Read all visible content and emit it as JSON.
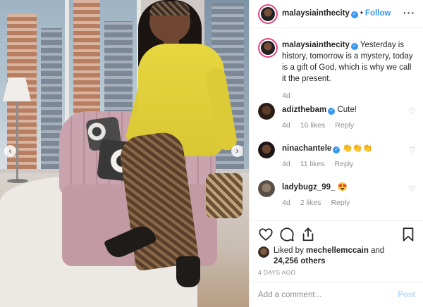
{
  "header": {
    "username": "malaysiainthecity",
    "separator": "•",
    "follow_label": "Follow",
    "more_icon": "more-horizontal-icon",
    "more_glyph": "···"
  },
  "caption": {
    "username": "malaysiainthecity",
    "text": "Yesterday is history, tomorrow is a mystery, today is a gift of God, which is why we call it the present.",
    "age": "4d"
  },
  "comments": [
    {
      "username": "adizthebam",
      "verified": true,
      "text": "Cute!",
      "age": "4d",
      "likes": "16 likes",
      "reply": "Reply"
    },
    {
      "username": "ninachantele",
      "verified": true,
      "text": "👏👏👏",
      "age": "4d",
      "likes": "11 likes",
      "reply": "Reply"
    },
    {
      "username": "ladybugz_99_",
      "verified": false,
      "text": "😍",
      "age": "4d",
      "likes": "2 likes",
      "reply": "Reply"
    }
  ],
  "likes": {
    "prefix": "Liked by ",
    "user": "mechellemccain",
    "middle": " and",
    "count": "24,256 others"
  },
  "timestamp": "4 DAYS AGO",
  "add_comment": {
    "placeholder": "Add a comment...",
    "post_label": "Post"
  },
  "nav": {
    "prev_glyph": "‹",
    "next_glyph": "›"
  },
  "colors": {
    "accent": "#3897f0",
    "ring": "#e23b79",
    "muted": "#8e8e8e",
    "post_disabled": "#b3dbff"
  }
}
